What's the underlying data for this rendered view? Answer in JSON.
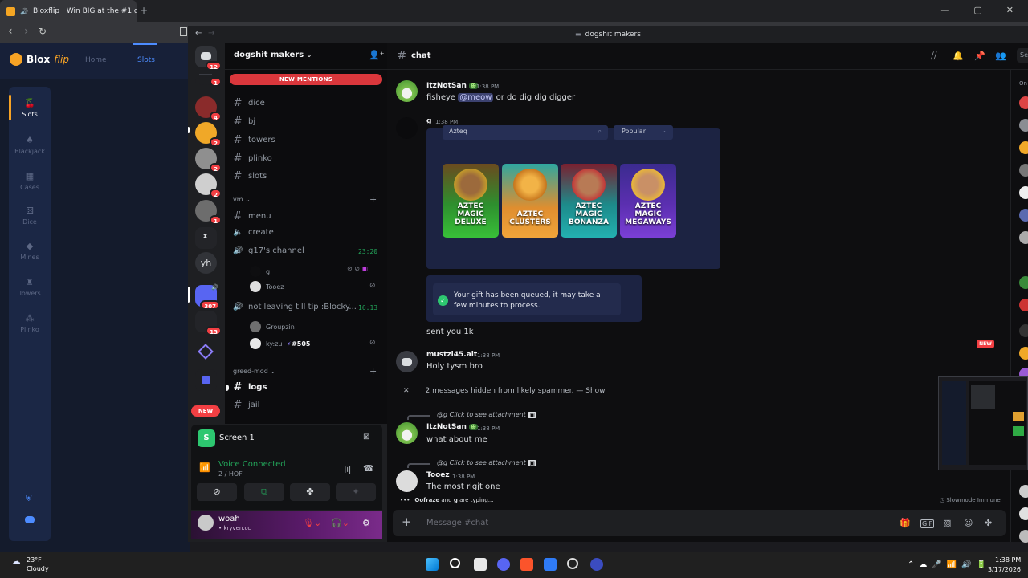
{
  "browser": {
    "tab_title": "Bloxflip | Win BIG at the #1 g",
    "new_tab": "+",
    "controls": [
      "—",
      "▢",
      "✕"
    ]
  },
  "bloxflip": {
    "logo_main": "Blox",
    "logo_sub": "flip",
    "nav_home": "Home",
    "nav_slots": "Slots",
    "sidebar": [
      {
        "label": "Slots",
        "icon": "slots-icon"
      },
      {
        "label": "Blackjack",
        "icon": "cards-icon"
      },
      {
        "label": "Cases",
        "icon": "case-icon"
      },
      {
        "label": "Dice",
        "icon": "dice-icon"
      },
      {
        "label": "Mines",
        "icon": "gem-icon"
      },
      {
        "label": "Towers",
        "icon": "tower-icon"
      },
      {
        "label": "Plinko",
        "icon": "plinko-icon"
      }
    ]
  },
  "discord": {
    "window_title": "dogshit makers",
    "servers": {
      "home_badge": "12",
      "badges": [
        "1",
        "4",
        "2",
        "2",
        "2",
        "1",
        "307",
        "13"
      ],
      "yh": "yh",
      "new_pill": "NEW"
    },
    "guild_name": "dogshit makers",
    "new_mentions": "NEW MENTIONS",
    "channels_top": [
      "dice",
      "bj",
      "towers",
      "plinko",
      "slots"
    ],
    "category_vm": "vm",
    "vm_channels": [
      "menu",
      "create"
    ],
    "voice_channel_1": "g17's channel",
    "voice_channel_1_timer": "23:20",
    "voice_users_1": [
      "g",
      "Tooez"
    ],
    "voice_channel_2": "not leaving till tip :Blocky...",
    "voice_channel_2_timer": "16:13",
    "voice_users_2": [
      "Groupzin",
      "ky:zu"
    ],
    "kyzu_tag": "#505",
    "category_greed": "greed-mod",
    "greed_channels": [
      "logs",
      "jail"
    ],
    "screen_label": "Screen 1",
    "screen_initial": "S",
    "voice_status": "Voice Connected",
    "voice_sub": "2 / HOF",
    "user_name": "woah",
    "user_sub": "• kryven.cc",
    "chat": {
      "channel": "chat",
      "search": "Se",
      "messages": {
        "m1_author": "ItzNotSan",
        "m1_time": "1:38 PM",
        "m1_text_before": "fisheye ",
        "m1_mention": "@meow",
        "m1_text_after": " or do dig dig digger",
        "m2_author": "g",
        "m2_time": "1:38 PM",
        "embed_search": "Azteq",
        "embed_sort": "Popular",
        "games": [
          "AZTEC\nMAGIC\nDELUXE",
          "AZTEC\nCLUSTERS",
          "AZTEC\nMAGIC\nBONANZA",
          "AZTEC\nMAGIC\nMEGAWAYS"
        ],
        "gift_text": "Your gift has been queued, it may take a few minutes to process.",
        "m2_text": "sent you 1k",
        "new_tag": "NEW",
        "m3_author": "mustzi45.alt",
        "m3_time": "1:38 PM",
        "m3_text": "Holy tysm bro",
        "hidden_text": "2 messages hidden from likely spammer. — ",
        "hidden_show": "Show",
        "reply1": "@g Click to see attachment",
        "m4_author": "ItzNotSan",
        "m4_time": "1:38 PM",
        "m4_text": "what about me",
        "reply2": "@g Click to see attachment",
        "m5_author": "Tooez",
        "m5_time": "1:38 PM",
        "m5_text": "The most rigjt one"
      },
      "typing_name1": "Oofraze",
      "typing_and": " and ",
      "typing_name2": "g",
      "typing_suffix": " are typing...",
      "slowmode": "Slowmode Immune",
      "input_placeholder": "Message #chat",
      "member_head": "On"
    }
  },
  "taskbar": {
    "temp": "23°F",
    "weather": "Cloudy",
    "time": "1:38 PM",
    "date": "3/17/2026"
  }
}
